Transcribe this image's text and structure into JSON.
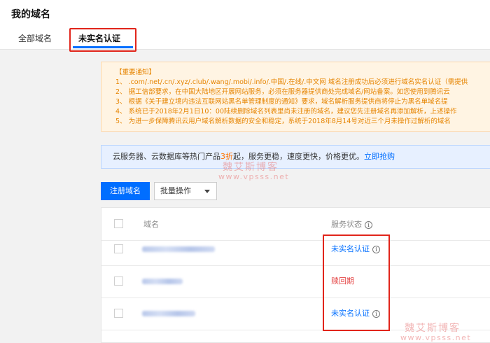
{
  "header": {
    "title": "我的域名",
    "tabs": [
      {
        "label": "全部域名"
      },
      {
        "label": "未实名认证"
      }
    ]
  },
  "notice": {
    "title": "【重要通知】",
    "lines": [
      "1、 .com/.net/.cn/.xyz/.club/.wang/.mobi/.info/.中国/.在线/.中文网 域名注册成功后必须进行域名实名认证（需提供",
      "2、 据工信部要求，在中国大陆地区开展网站服务，必须在服务器提供商处完成域名/网站备案。如您使用到腾讯云",
      "3、 根据《关于建立境内违法互联网站黑名单管理制度的通知》要求，域名解析服务提供商将停止为黑名单域名提",
      "4、 系统已于2018年2月1日10：00陆续删除域名列表里尚未注册的域名，建议您先注册域名再添加解析，上述操作",
      "5、 为进一步保障腾讯云用户域名解析数据的安全和稳定，系统于2018年8月14号对近三个月未操作过解析的域名"
    ]
  },
  "promo": {
    "prefix": "云服务器、云数据库等热门产品",
    "discount": "3折",
    "middle": "起，服务更稳，速度更快，价格更优。",
    "link": "立即抢购"
  },
  "watermark": {
    "text": "魏艾斯博客",
    "url": "www.vpsss.net"
  },
  "toolbar": {
    "register_label": "注册域名",
    "batch_label": "批量操作"
  },
  "table": {
    "headers": {
      "domain": "域名",
      "status": "服务状态"
    },
    "rows": [
      {
        "status": "未实名认证"
      },
      {
        "status": "赎回期"
      },
      {
        "status": "未实名认证"
      }
    ]
  },
  "icons": {
    "info": "info-circle-icon",
    "caret": "chevron-down-icon"
  },
  "colors": {
    "accent": "#006eff",
    "danger": "#e54545",
    "notice_text": "#e68400"
  }
}
